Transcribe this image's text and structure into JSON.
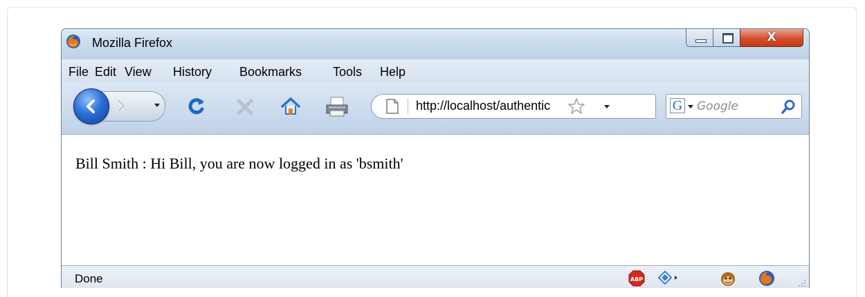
{
  "window": {
    "title": "Mozilla Firefox",
    "close_label": "X"
  },
  "menubar": {
    "items": [
      "File",
      "Edit",
      "View",
      "History",
      "Bookmarks",
      "Tools",
      "Help"
    ]
  },
  "toolbar": {
    "icons": [
      "back-icon",
      "forward-icon",
      "dropdown-icon",
      "reload-icon",
      "stop-icon",
      "home-icon",
      "print-icon"
    ],
    "url": "http://localhost/authentic",
    "search_placeholder": "Google",
    "search_engine_letter": "G"
  },
  "page": {
    "body_text": "Bill Smith : Hi Bill, you are now logged in as 'bsmith'"
  },
  "statusbar": {
    "status": "Done",
    "icons": [
      "adblock-icon",
      "addon-icon",
      "monkey-icon",
      "firefox-icon"
    ]
  },
  "colors": {
    "accent_blue": "#2c6fd6",
    "close_red": "#d1512c"
  }
}
